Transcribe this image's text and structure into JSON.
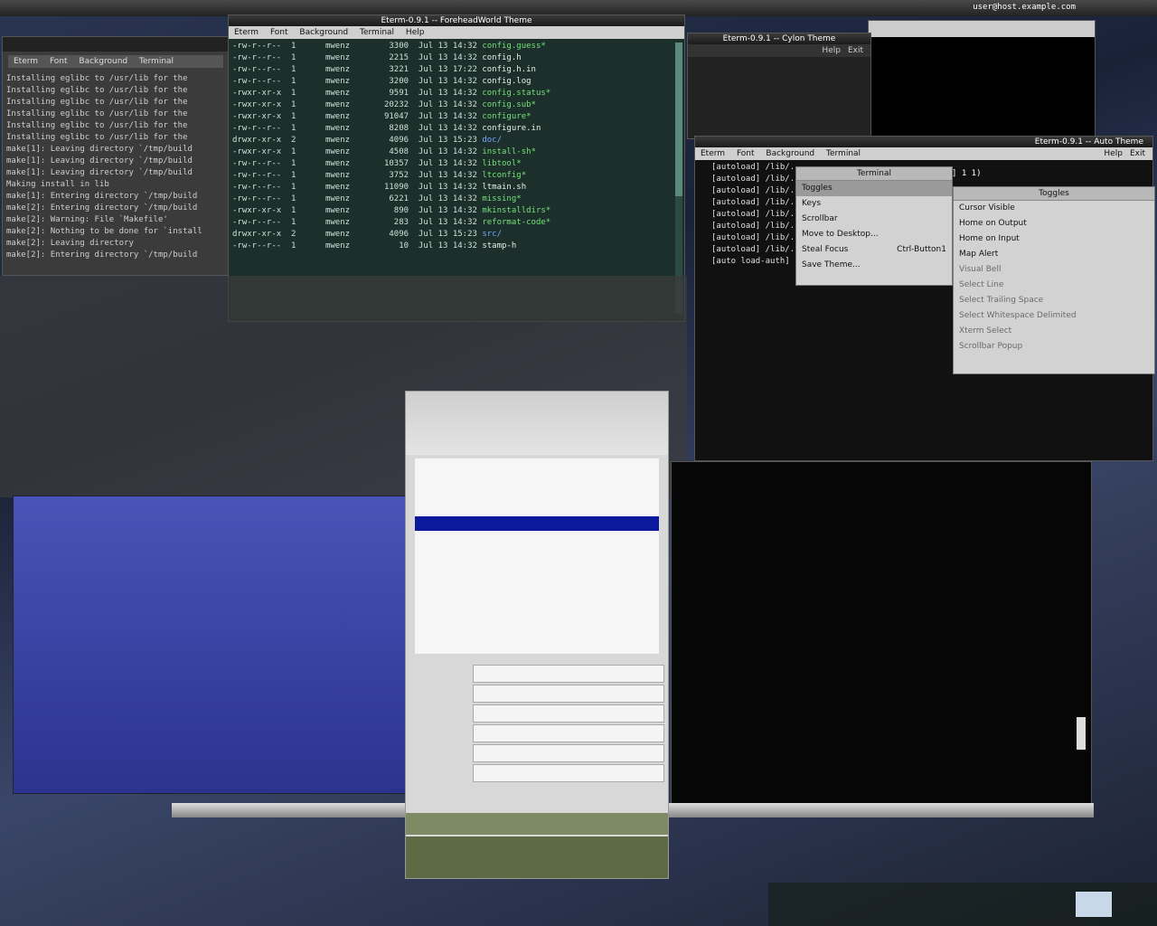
{
  "top_bar": {
    "app_title": "Eterm-0.9.1 -- ForeheadWorld Theme",
    "user_host": "user@host.example.com"
  },
  "menus": {
    "main": [
      "Eterm",
      "Font",
      "Background",
      "Terminal",
      "Help"
    ],
    "right": [
      "Help",
      "Exit"
    ]
  },
  "left_terminal": {
    "menu": [
      "Eterm",
      "Font",
      "Background",
      "Terminal"
    ],
    "lines": [
      "Installing eglibc to /usr/lib for the",
      "Installing eglibc to /usr/lib for the",
      "Installing eglibc to /usr/lib for the",
      "Installing eglibc to /usr/lib for the",
      "Installing eglibc to /usr/lib for the",
      "Installing eglibc to /usr/lib for the",
      "make[1]: Leaving directory `/tmp/build",
      "make[1]: Leaving directory `/tmp/build",
      "make[1]: Leaving directory `/tmp/build",
      "Making install in lib",
      "make[1]: Entering directory `/tmp/build",
      "make[2]: Entering directory `/tmp/build",
      "make[2]: Warning: File `Makefile'",
      "make[2]: Nothing to be done for `install",
      "make[2]: Leaving directory",
      "make[2]: Entering directory `/tmp/build"
    ]
  },
  "listing_terminal": {
    "title": "Eterm-0.9.1 -- ForeheadWorld Theme",
    "rows": [
      {
        "perm": "-rw-r--r--",
        "links": "1",
        "owner": "mwenz",
        "size": "3300",
        "date": "Jul 13 14:32",
        "name": "config.guess*",
        "color": "green"
      },
      {
        "perm": "-rw-r--r--",
        "links": "1",
        "owner": "mwenz",
        "size": "2215",
        "date": "Jul 13 14:32",
        "name": "config.h",
        "color": "white"
      },
      {
        "perm": "-rw-r--r--",
        "links": "1",
        "owner": "mwenz",
        "size": "3221",
        "date": "Jul 13 17:22",
        "name": "config.h.in",
        "color": "white"
      },
      {
        "perm": "-rw-r--r--",
        "links": "1",
        "owner": "mwenz",
        "size": "3200",
        "date": "Jul 13 14:32",
        "name": "config.log",
        "color": "white"
      },
      {
        "perm": "-rwxr-xr-x",
        "links": "1",
        "owner": "mwenz",
        "size": "9591",
        "date": "Jul 13 14:32",
        "name": "config.status*",
        "color": "green"
      },
      {
        "perm": "-rwxr-xr-x",
        "links": "1",
        "owner": "mwenz",
        "size": "20232",
        "date": "Jul 13 14:32",
        "name": "config.sub*",
        "color": "green"
      },
      {
        "perm": "-rwxr-xr-x",
        "links": "1",
        "owner": "mwenz",
        "size": "91047",
        "date": "Jul 13 14:32",
        "name": "configure*",
        "color": "green"
      },
      {
        "perm": "-rw-r--r--",
        "links": "1",
        "owner": "mwenz",
        "size": "8208",
        "date": "Jul 13 14:32",
        "name": "configure.in",
        "color": "white"
      },
      {
        "perm": "drwxr-xr-x",
        "links": "2",
        "owner": "mwenz",
        "size": "4096",
        "date": "Jul 13 15:23",
        "name": "doc/",
        "color": "blue"
      },
      {
        "perm": "-rwxr-xr-x",
        "links": "1",
        "owner": "mwenz",
        "size": "4508",
        "date": "Jul 13 14:32",
        "name": "install-sh*",
        "color": "green"
      },
      {
        "perm": "-rw-r--r--",
        "links": "1",
        "owner": "mwenz",
        "size": "10357",
        "date": "Jul 13 14:32",
        "name": "libtool*",
        "color": "green"
      },
      {
        "perm": "-rw-r--r--",
        "links": "1",
        "owner": "mwenz",
        "size": "3752",
        "date": "Jul 13 14:32",
        "name": "ltconfig*",
        "color": "green"
      },
      {
        "perm": "-rw-r--r--",
        "links": "1",
        "owner": "mwenz",
        "size": "11090",
        "date": "Jul 13 14:32",
        "name": "ltmain.sh",
        "color": "white"
      },
      {
        "perm": "-rw-r--r--",
        "links": "1",
        "owner": "mwenz",
        "size": "6221",
        "date": "Jul 13 14:32",
        "name": "missing*",
        "color": "green"
      },
      {
        "perm": "-rwxr-xr-x",
        "links": "1",
        "owner": "mwenz",
        "size": "890",
        "date": "Jul 13 14:32",
        "name": "mkinstalldirs*",
        "color": "green"
      },
      {
        "perm": "-rw-r--r--",
        "links": "1",
        "owner": "mwenz",
        "size": "283",
        "date": "Jul 13 14:32",
        "name": "reformat-code*",
        "color": "green"
      },
      {
        "perm": "drwxr-xr-x",
        "links": "2",
        "owner": "mwenz",
        "size": "4096",
        "date": "Jul 13 15:23",
        "name": "src/",
        "color": "blue"
      },
      {
        "perm": "-rw-r--r--",
        "links": "1",
        "owner": "mwenz",
        "size": "10",
        "date": "Jul 13 14:32",
        "name": "stamp-h",
        "color": "white"
      }
    ]
  },
  "cylon_terminal": {
    "title": "Eterm-0.9.1 -- Cylon Theme"
  },
  "auto_terminal": {
    "title": "Eterm-0.9.1 -- Auto Theme",
    "lines": [
      "[autoload] /lib/...",
      "[autoload] /lib/...",
      "[autoload] /lib/...",
      "[autoload] /lib/...",
      "[autoload] /lib/...",
      "[autoload] /lib/...",
      "[autoload] /lib/...",
      "[autoload] /lib/...",
      "[auto load-auth]",
      "",
      "",
      "",
      "",
      "",
      "",
      "",
      "",
      "",
      "",
      "",
      "",
      ""
    ],
    "prompt_fragment": "] 1 1)"
  },
  "terminal_menu": {
    "header": "Terminal",
    "items": [
      "Toggles",
      "Keys",
      "Scrollbar",
      "Move to Desktop...",
      "Steal Focus",
      "Save Theme..."
    ],
    "shortcut": "Ctrl-Button1"
  },
  "toggles_menu": {
    "header": "Toggles",
    "items": [
      "Cursor Visible",
      "Home on Output",
      "Home on Input",
      "Map Alert",
      "Visual Bell",
      "Select Line",
      "Select Trailing Space",
      "Select Whitespace Delimited",
      "Xterm Select",
      "Scrollbar Popup"
    ]
  }
}
